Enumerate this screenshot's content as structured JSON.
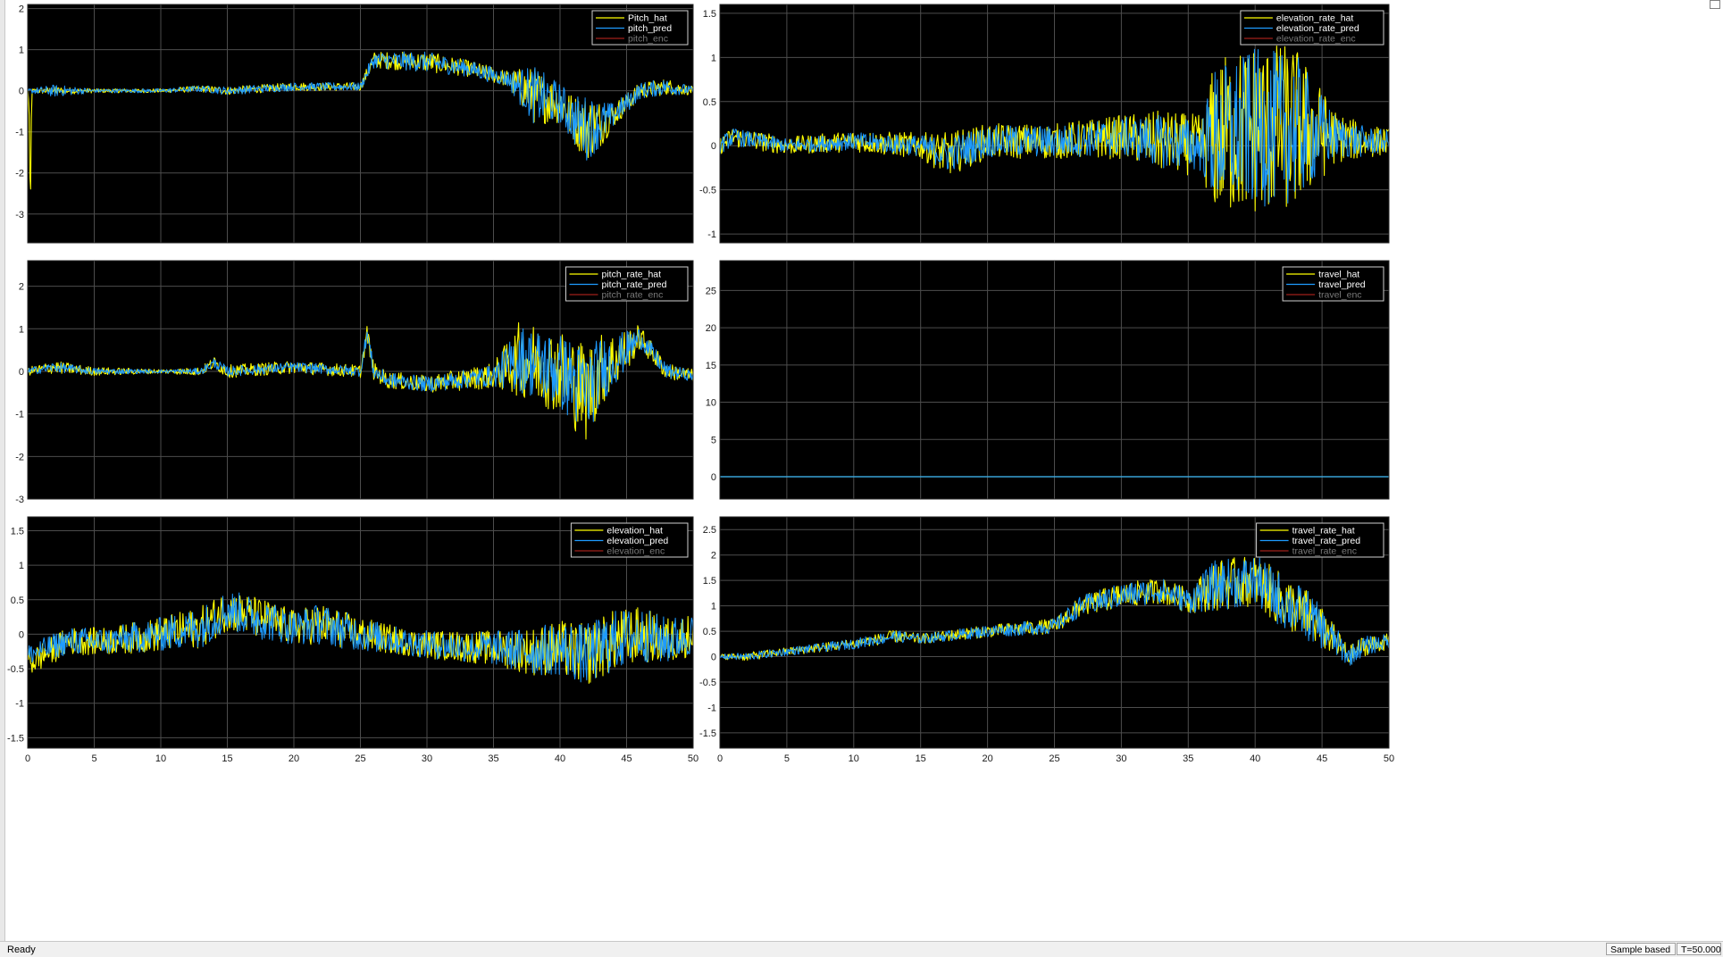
{
  "window": {
    "status": "Ready",
    "sample_mode": "Sample based",
    "time_readout": "T=50.000"
  },
  "colors": {
    "background": "#000000",
    "grid": "#4d4d4d",
    "hat": "#ffff00",
    "pred": "#1e9bff",
    "enc": "#a0201a"
  },
  "chart_data": [
    {
      "type": "line",
      "panel": "top-left",
      "xlim": [
        0,
        50
      ],
      "ylim": [
        -3.7,
        2.1
      ],
      "xticks": [
        0,
        5,
        10,
        15,
        20,
        25,
        30,
        35,
        40,
        45,
        50
      ],
      "yticks": [
        -3,
        -2,
        -1,
        0,
        1,
        2
      ],
      "show_xtick_labels": false,
      "grid": true,
      "legend_position": "top-right",
      "legend": [
        "Pitch_hat",
        "pitch_pred",
        "pitch_enc"
      ],
      "series": [
        {
          "name": "Pitch_hat",
          "color": "#ffff00",
          "x": [
            0,
            0.1,
            0.2,
            0.3,
            2,
            5,
            10,
            13,
            15,
            20,
            25,
            26,
            30,
            33,
            36,
            38,
            40,
            41,
            42,
            43,
            44,
            46,
            48,
            50
          ],
          "y": [
            0,
            -0.3,
            -3.1,
            0,
            0,
            0,
            0,
            0.05,
            0,
            0.1,
            0.1,
            0.75,
            0.7,
            0.55,
            0.3,
            -0.1,
            -0.3,
            -0.7,
            -0.9,
            -0.8,
            -0.6,
            0,
            0.1,
            0
          ],
          "band": [
            0.05,
            0.05,
            0.05,
            0.05,
            0.1,
            0.05,
            0.05,
            0.08,
            0.1,
            0.1,
            0.1,
            0.2,
            0.25,
            0.2,
            0.2,
            0.7,
            0.5,
            0.6,
            0.8,
            0.6,
            0.3,
            0.2,
            0.2,
            0.1
          ]
        },
        {
          "name": "pitch_pred",
          "color": "#1e9bff",
          "x": [
            0,
            2,
            5,
            10,
            13,
            15,
            20,
            25,
            26,
            30,
            33,
            36,
            38,
            40,
            41,
            42,
            43,
            44,
            46,
            48,
            50
          ],
          "y": [
            0,
            0,
            0,
            0,
            0.05,
            0,
            0.1,
            0.1,
            0.75,
            0.7,
            0.55,
            0.3,
            -0.1,
            -0.3,
            -0.7,
            -0.9,
            -0.8,
            -0.6,
            0,
            0.1,
            0
          ],
          "band": [
            0.05,
            0.15,
            0.05,
            0.05,
            0.08,
            0.1,
            0.1,
            0.1,
            0.2,
            0.25,
            0.2,
            0.2,
            0.7,
            0.5,
            0.6,
            0.8,
            0.6,
            0.3,
            0.2,
            0.2,
            0.1
          ]
        },
        {
          "name": "pitch_enc",
          "color": "#a0201a",
          "x": [],
          "y": []
        }
      ]
    },
    {
      "type": "line",
      "panel": "top-right",
      "xlim": [
        0,
        50
      ],
      "ylim": [
        -1.1,
        1.6
      ],
      "xticks": [
        0,
        5,
        10,
        15,
        20,
        25,
        30,
        35,
        40,
        45,
        50
      ],
      "yticks": [
        -1,
        -0.5,
        0,
        0.5,
        1,
        1.5
      ],
      "show_xtick_labels": false,
      "grid": true,
      "legend_position": "top-right",
      "legend": [
        "elevation_rate_hat",
        "elevation_rate_pred",
        "elevation_rate_enc"
      ],
      "series": [
        {
          "name": "elevation_rate_hat",
          "color": "#ffff00",
          "x": [
            0,
            1,
            5,
            10,
            15,
            17,
            20,
            25,
            30,
            33,
            36,
            37,
            40,
            43,
            46,
            48,
            50
          ],
          "y": [
            0,
            0.1,
            0,
            0.05,
            0,
            -0.1,
            0.05,
            0.05,
            0.1,
            0.05,
            0,
            0.1,
            0.2,
            0.2,
            0.1,
            0.05,
            0.05
          ],
          "band": [
            0.1,
            0.12,
            0.1,
            0.12,
            0.15,
            0.25,
            0.2,
            0.2,
            0.25,
            0.35,
            0.35,
            0.9,
            1.0,
            0.95,
            0.3,
            0.2,
            0.15
          ]
        },
        {
          "name": "elevation_rate_pred",
          "color": "#1e9bff",
          "x": [
            0,
            1,
            5,
            10,
            15,
            17,
            20,
            25,
            30,
            33,
            36,
            37,
            40,
            43,
            46,
            48,
            50
          ],
          "y": [
            0,
            0.1,
            0,
            0.05,
            0,
            -0.1,
            0.05,
            0.05,
            0.1,
            0.05,
            0,
            0.1,
            0.2,
            0.2,
            0.1,
            0.05,
            0.05
          ],
          "band": [
            0.1,
            0.1,
            0.08,
            0.1,
            0.12,
            0.2,
            0.18,
            0.18,
            0.22,
            0.3,
            0.3,
            0.8,
            0.9,
            0.85,
            0.25,
            0.18,
            0.12
          ]
        },
        {
          "name": "elevation_rate_enc",
          "color": "#a0201a",
          "x": [],
          "y": []
        }
      ]
    },
    {
      "type": "line",
      "panel": "middle-left",
      "xlim": [
        0,
        50
      ],
      "ylim": [
        -3,
        2.6
      ],
      "xticks": [
        0,
        5,
        10,
        15,
        20,
        25,
        30,
        35,
        40,
        45,
        50
      ],
      "yticks": [
        -3,
        -2,
        -1,
        0,
        1,
        2
      ],
      "show_xtick_labels": false,
      "grid": true,
      "legend_position": "top-right",
      "legend": [
        "pitch_rate_hat",
        "pitch_rate_pred",
        "pitch_rate_enc"
      ],
      "series": [
        {
          "name": "pitch_rate_hat",
          "color": "#ffff00",
          "x": [
            0,
            2,
            5,
            10,
            13,
            14,
            15,
            20,
            25,
            25.5,
            26,
            27,
            30,
            35,
            37,
            40,
            42,
            43,
            45,
            46,
            48,
            50
          ],
          "y": [
            0,
            0.1,
            0,
            0,
            0,
            0.2,
            0,
            0.1,
            0,
            0.9,
            0,
            -0.2,
            -0.3,
            -0.1,
            0.3,
            0,
            -0.5,
            0,
            0.5,
            0.8,
            0,
            -0.1
          ],
          "band": [
            0.1,
            0.15,
            0.1,
            0.05,
            0.1,
            0.15,
            0.15,
            0.15,
            0.15,
            0.2,
            0.2,
            0.2,
            0.2,
            0.3,
            0.9,
            1.0,
            1.2,
            0.9,
            0.5,
            0.3,
            0.2,
            0.15
          ]
        },
        {
          "name": "pitch_rate_pred",
          "color": "#1e9bff",
          "x": [
            0,
            2,
            5,
            10,
            13,
            14,
            15,
            20,
            25,
            25.5,
            26,
            27,
            30,
            35,
            37,
            40,
            42,
            43,
            45,
            46,
            48,
            50
          ],
          "y": [
            0,
            0.1,
            0,
            0,
            0,
            0.2,
            0,
            0.1,
            0,
            0.9,
            0,
            -0.2,
            -0.3,
            -0.1,
            0.3,
            0,
            -0.5,
            0,
            0.5,
            0.8,
            0,
            -0.1
          ],
          "band": [
            0.08,
            0.12,
            0.08,
            0.04,
            0.08,
            0.12,
            0.12,
            0.12,
            0.12,
            0.18,
            0.18,
            0.18,
            0.18,
            0.25,
            0.8,
            0.9,
            1.1,
            0.8,
            0.45,
            0.25,
            0.18,
            0.12
          ]
        },
        {
          "name": "pitch_rate_enc",
          "color": "#a0201a",
          "x": [],
          "y": []
        }
      ]
    },
    {
      "type": "line",
      "panel": "middle-right",
      "xlim": [
        0,
        50
      ],
      "ylim": [
        -3,
        29
      ],
      "xticks": [
        0,
        5,
        10,
        15,
        20,
        25,
        30,
        35,
        40,
        45,
        50
      ],
      "yticks": [
        0,
        5,
        10,
        15,
        20,
        25
      ],
      "show_xtick_labels": false,
      "grid": true,
      "legend_position": "top-right",
      "legend": [
        "travel_hat",
        "travel_pred",
        "travel_enc"
      ],
      "series": [
        {
          "name": "travel_hat",
          "color": "#ffff00",
          "x": [
            0,
            50
          ],
          "y": [
            0,
            0
          ]
        },
        {
          "name": "travel_pred",
          "color": "#1e9bff",
          "x": [
            0,
            50
          ],
          "y": [
            0,
            0
          ]
        },
        {
          "name": "travel_enc",
          "color": "#a0201a",
          "x": [],
          "y": []
        }
      ]
    },
    {
      "type": "line",
      "panel": "bottom-left",
      "xlim": [
        0,
        50
      ],
      "ylim": [
        -1.65,
        1.7
      ],
      "xticks": [
        0,
        5,
        10,
        15,
        20,
        25,
        30,
        35,
        40,
        45,
        50
      ],
      "yticks": [
        -1.5,
        -1,
        -0.5,
        0,
        0.5,
        1,
        1.5
      ],
      "show_xtick_labels": true,
      "grid": true,
      "legend_position": "top-right",
      "legend": [
        "elevation_hat",
        "elevation_pred",
        "elevation_enc"
      ],
      "series": [
        {
          "name": "elevation_hat",
          "color": "#ffff00",
          "x": [
            0,
            0.3,
            3,
            6,
            10,
            13,
            15,
            18,
            20,
            22,
            25,
            28,
            30,
            35,
            38,
            40,
            42,
            44,
            46,
            48,
            50
          ],
          "y": [
            -0.3,
            -0.4,
            -0.1,
            -0.1,
            0,
            0.1,
            0.35,
            0.2,
            0.1,
            0.15,
            0,
            -0.1,
            -0.15,
            -0.2,
            -0.25,
            -0.2,
            -0.3,
            -0.1,
            0,
            -0.1,
            0
          ],
          "band": [
            0.1,
            0.2,
            0.2,
            0.2,
            0.25,
            0.3,
            0.3,
            0.3,
            0.25,
            0.3,
            0.25,
            0.2,
            0.2,
            0.25,
            0.35,
            0.4,
            0.45,
            0.45,
            0.4,
            0.35,
            0.3
          ]
        },
        {
          "name": "elevation_pred",
          "color": "#1e9bff",
          "x": [
            0,
            3,
            6,
            10,
            13,
            15,
            18,
            20,
            22,
            25,
            28,
            30,
            35,
            38,
            40,
            42,
            44,
            46,
            48,
            50
          ],
          "y": [
            -0.3,
            -0.1,
            -0.1,
            0,
            0.1,
            0.35,
            0.2,
            0.1,
            0.15,
            0,
            -0.1,
            -0.15,
            -0.2,
            -0.25,
            -0.2,
            -0.3,
            -0.1,
            0,
            -0.1,
            0
          ],
          "band": [
            0.15,
            0.2,
            0.2,
            0.25,
            0.3,
            0.3,
            0.3,
            0.25,
            0.3,
            0.25,
            0.2,
            0.2,
            0.25,
            0.35,
            0.4,
            0.45,
            0.45,
            0.4,
            0.35,
            0.3
          ]
        },
        {
          "name": "elevation_enc",
          "color": "#a0201a",
          "x": [],
          "y": []
        }
      ]
    },
    {
      "type": "line",
      "panel": "bottom-right",
      "xlim": [
        0,
        50
      ],
      "ylim": [
        -1.8,
        2.75
      ],
      "xticks": [
        0,
        5,
        10,
        15,
        20,
        25,
        30,
        35,
        40,
        45,
        50
      ],
      "yticks": [
        -1.5,
        -1,
        -0.5,
        0,
        0.5,
        1,
        1.5,
        2,
        2.5
      ],
      "show_xtick_labels": true,
      "grid": true,
      "legend_position": "top-right",
      "legend": [
        "travel_rate_hat",
        "travel_rate_pred",
        "travel_rate_enc"
      ],
      "series": [
        {
          "name": "travel_rate_hat",
          "color": "#ffff00",
          "x": [
            0,
            2,
            5,
            10,
            13,
            15,
            20,
            25,
            27,
            30,
            33,
            35,
            37,
            40,
            42,
            44,
            46,
            47,
            48,
            50
          ],
          "y": [
            0,
            0,
            0.1,
            0.25,
            0.4,
            0.35,
            0.5,
            0.6,
            1.0,
            1.2,
            1.3,
            1.1,
            1.4,
            1.5,
            1.1,
            0.8,
            0.3,
            0,
            0.2,
            0.3
          ],
          "band": [
            0.05,
            0.08,
            0.08,
            0.1,
            0.12,
            0.1,
            0.12,
            0.15,
            0.2,
            0.25,
            0.25,
            0.25,
            0.5,
            0.5,
            0.55,
            0.5,
            0.3,
            0.2,
            0.2,
            0.15
          ]
        },
        {
          "name": "travel_rate_pred",
          "color": "#1e9bff",
          "x": [
            0,
            2,
            5,
            10,
            13,
            15,
            20,
            25,
            27,
            30,
            33,
            35,
            37,
            40,
            42,
            44,
            46,
            47,
            48,
            50
          ],
          "y": [
            0,
            0,
            0.1,
            0.25,
            0.4,
            0.35,
            0.5,
            0.6,
            1.0,
            1.2,
            1.3,
            1.1,
            1.4,
            1.5,
            1.1,
            0.8,
            0.3,
            0,
            0.2,
            0.3
          ],
          "band": [
            0.05,
            0.08,
            0.08,
            0.1,
            0.12,
            0.1,
            0.12,
            0.15,
            0.2,
            0.25,
            0.25,
            0.25,
            0.5,
            0.5,
            0.55,
            0.5,
            0.3,
            0.2,
            0.2,
            0.15
          ]
        },
        {
          "name": "travel_rate_enc",
          "color": "#a0201a",
          "x": [],
          "y": []
        }
      ]
    }
  ]
}
